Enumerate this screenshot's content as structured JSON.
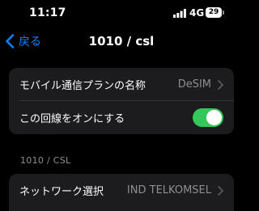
{
  "status_bar": {
    "time": "11:17",
    "network": "4G",
    "battery": "29",
    "icons": [
      "signal-icon",
      "battery-icon"
    ]
  },
  "nav": {
    "back_label": "戻る",
    "title": "1010 / csl",
    "icons": [
      "chevron-left-icon"
    ]
  },
  "plan_group": {
    "rows": [
      {
        "label": "モバイル通信プランの名称",
        "value": "DeSIM"
      },
      {
        "label": "この回線をオンにする",
        "toggle_on": true
      }
    ]
  },
  "carrier_section": {
    "header": "1010 / CSL",
    "rows": [
      {
        "label": "ネットワーク選択",
        "value": "IND TELKOMSEL"
      }
    ]
  },
  "colors": {
    "accent": "#0a84ff",
    "toggle_on": "#34c759",
    "cell_background": "#1c1c1e",
    "secondary_text": "#8e8e93"
  }
}
